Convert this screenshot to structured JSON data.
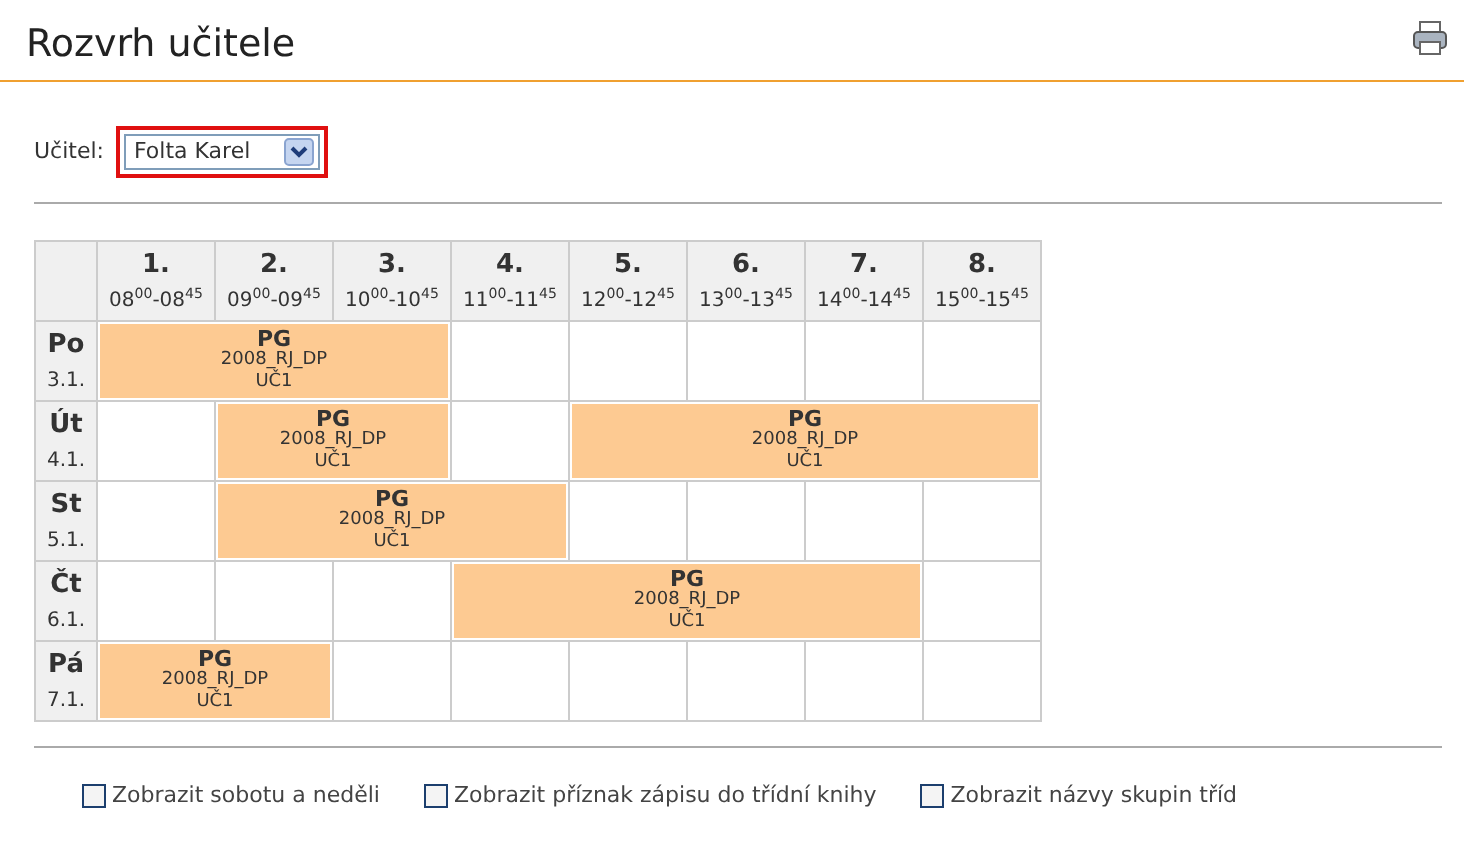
{
  "page": {
    "title": "Rozvrh učitele"
  },
  "teacher": {
    "label": "Učitel:",
    "value": "Folta Karel"
  },
  "periods": [
    {
      "number": "1.",
      "time": "08$^{00}$-08$^{45}$"
    },
    {
      "number": "2.",
      "time": "09$^{00}$-09$^{45}$"
    },
    {
      "number": "3.",
      "time": "10$^{00}$-10$^{45}$"
    },
    {
      "number": "4.",
      "time": "11$^{00}$-11$^{45}$"
    },
    {
      "number": "5.",
      "time": "12$^{00}$-12$^{45}$"
    },
    {
      "number": "6.",
      "time": "13$^{00}$-13$^{45}$"
    },
    {
      "number": "7.",
      "time": "14$^{00}$-14$^{45}$"
    },
    {
      "number": "8.",
      "time": "15$^{00}$-15$^{45}$"
    }
  ],
  "days": [
    {
      "day": "Po",
      "date": "3.1.",
      "cells": [
        {
          "kind": "lesson",
          "subject": "PG",
          "group": "2008_RJ_DP",
          "room": "UČ1"
        },
        {
          "kind": "continued"
        },
        {
          "kind": "continued"
        },
        {
          "kind": "empty"
        },
        {
          "kind": "empty"
        },
        {
          "kind": "empty"
        },
        {
          "kind": "empty"
        },
        {
          "kind": "empty"
        }
      ]
    },
    {
      "day": "Út",
      "date": "4.1.",
      "cells": [
        {
          "kind": "empty"
        },
        {
          "kind": "lesson",
          "subject": "PG",
          "group": "2008_RJ_DP",
          "room": "UČ1"
        },
        {
          "kind": "continued"
        },
        {
          "kind": "empty"
        },
        {
          "kind": "lesson",
          "subject": "PG",
          "group": "2008_RJ_DP",
          "room": "UČ1"
        },
        {
          "kind": "continued"
        },
        {
          "kind": "continued"
        },
        {
          "kind": "continued"
        }
      ]
    },
    {
      "day": "St",
      "date": "5.1.",
      "cells": [
        {
          "kind": "empty"
        },
        {
          "kind": "lesson",
          "subject": "PG",
          "group": "2008_RJ_DP",
          "room": "UČ1"
        },
        {
          "kind": "continued"
        },
        {
          "kind": "continued"
        },
        {
          "kind": "empty"
        },
        {
          "kind": "empty"
        },
        {
          "kind": "empty"
        },
        {
          "kind": "empty"
        }
      ]
    },
    {
      "day": "Čt",
      "date": "6.1.",
      "cells": [
        {
          "kind": "empty"
        },
        {
          "kind": "empty"
        },
        {
          "kind": "empty"
        },
        {
          "kind": "lesson",
          "subject": "PG",
          "group": "2008_RJ_DP",
          "room": "UČ1"
        },
        {
          "kind": "continued"
        },
        {
          "kind": "continued"
        },
        {
          "kind": "continued"
        },
        {
          "kind": "empty"
        }
      ]
    },
    {
      "day": "Pá",
      "date": "7.1.",
      "cells": [
        {
          "kind": "lesson",
          "subject": "PG",
          "group": "2008_RJ_DP",
          "room": "UČ1"
        },
        {
          "kind": "continued"
        },
        {
          "kind": "empty"
        },
        {
          "kind": "empty"
        },
        {
          "kind": "empty"
        },
        {
          "kind": "empty"
        },
        {
          "kind": "empty"
        },
        {
          "kind": "empty"
        }
      ]
    }
  ],
  "options": [
    {
      "label": "Zobrazit sobotu a neděli",
      "checked": false
    },
    {
      "label": "Zobrazit příznak zápisu do třídní knihy",
      "checked": false
    },
    {
      "label": "Zobrazit názvy skupin tříd",
      "checked": false
    }
  ]
}
